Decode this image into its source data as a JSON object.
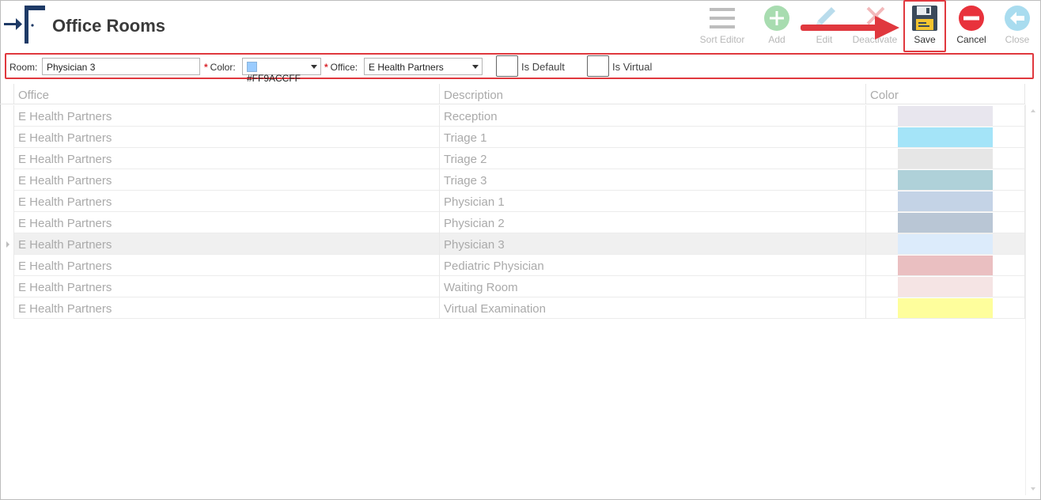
{
  "header": {
    "title": "Office Rooms",
    "logo_icon": "arrow-into-door-logo"
  },
  "toolbar": {
    "sort_editor": "Sort Editor",
    "add": "Add",
    "edit": "Edit",
    "deactivate": "Deactivate",
    "save": "Save",
    "cancel": "Cancel",
    "close": "Close"
  },
  "editbar": {
    "room_label": "Room:",
    "room_value": "Physician 3",
    "required_mark": "*",
    "color_label": "Color:",
    "color_value": "#FF9ACCFF",
    "office_label": "Office:",
    "office_value": "E Health Partners",
    "is_default_label": "Is Default",
    "is_virtual_label": "Is Virtual"
  },
  "grid": {
    "columns": [
      "Office",
      "Description",
      "Color"
    ],
    "rows": [
      {
        "office": "E Health Partners",
        "description": "Reception",
        "color": "#E8E6EE"
      },
      {
        "office": "E Health Partners",
        "description": "Triage 1",
        "color": "#A4E4F8"
      },
      {
        "office": "E Health Partners",
        "description": "Triage 2",
        "color": "#E6E6E6"
      },
      {
        "office": "E Health Partners",
        "description": "Triage 3",
        "color": "#AFD1D9"
      },
      {
        "office": "E Health Partners",
        "description": "Physician 1",
        "color": "#C4D3E6"
      },
      {
        "office": "E Health Partners",
        "description": "Physician 2",
        "color": "#B9C6D5"
      },
      {
        "office": "E Health Partners",
        "description": "Physician 3",
        "color": "#DCEBFB",
        "selected": true
      },
      {
        "office": "E Health Partners",
        "description": "Pediatric Physician",
        "color": "#EABFC1"
      },
      {
        "office": "E Health Partners",
        "description": "Waiting Room",
        "color": "#F5E4E4"
      },
      {
        "office": "E Health Partners",
        "description": "Virtual Examination",
        "color": "#FEFE9C"
      }
    ]
  },
  "colors": {
    "highlight_red": "#E0383E",
    "logo_blue": "#1E3A66",
    "disabled_green": "#9AD3A3",
    "cancel_red": "#E8323C",
    "close_blue": "#9FD7EC"
  }
}
